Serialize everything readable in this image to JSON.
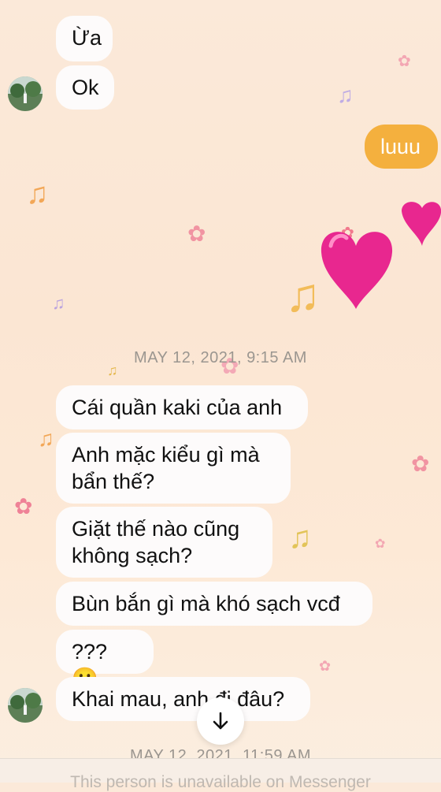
{
  "messages": [
    {
      "text": "Ừa",
      "sender": "them"
    },
    {
      "text": "Ok",
      "sender": "them"
    },
    {
      "text": "luuu",
      "sender": "me"
    },
    {
      "text": "Cái quần kaki của anh",
      "sender": "them"
    },
    {
      "text": "Anh mặc kiểu gì mà\nbẩn thế?",
      "sender": "them"
    },
    {
      "text": "Giặt thế nào cũng\nkhông sạch?",
      "sender": "them"
    },
    {
      "text": "Bùn bắn gì mà khó sạch vcđ",
      "sender": "them"
    },
    {
      "text": "??? 😀",
      "sender": "them"
    },
    {
      "text": "Khai mau, anh đi đâu?",
      "sender": "them"
    }
  ],
  "timestamps": [
    "MAY 12, 2021, 9:15 AM",
    "MAY 12, 2021, 11:59 AM"
  ],
  "footer_text": "This person is unavailable on Messenger",
  "colors": {
    "accent": "#f4b03e",
    "incoming_bubble": "#fdfbfb",
    "heart": "#e8278f"
  },
  "icons": {
    "scroll_down": "arrow-down-icon",
    "avatar": "avatar",
    "reaction": "heart-icon",
    "theme_decoration": "music-note-icon"
  }
}
